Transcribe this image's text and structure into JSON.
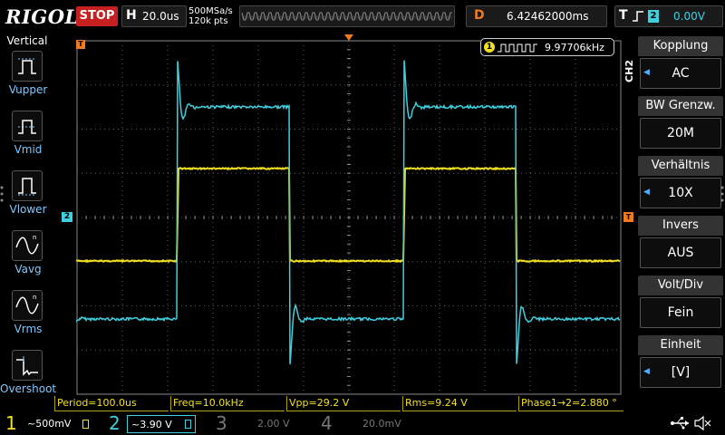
{
  "topbar": {
    "brand": "RIGOL",
    "run_state": "STOP",
    "timebase_letter": "H",
    "timebase": "20.0us",
    "sample_rate": "500MSa/s",
    "memory_depth": "120k pts",
    "delay_letter": "D",
    "delay": "6.42462000ms",
    "trigger_letter": "T",
    "trigger_source": "2",
    "trigger_level": "0.00V"
  },
  "leftbar": {
    "title": "Vertical",
    "items": [
      {
        "label": "Vupper",
        "icon": "vupper-icon"
      },
      {
        "label": "Vmid",
        "icon": "vmid-icon"
      },
      {
        "label": "Vlower",
        "icon": "vlower-icon"
      },
      {
        "label": "Vavg",
        "icon": "vavg-icon"
      },
      {
        "label": "Vrms",
        "icon": "vrms-icon"
      },
      {
        "label": "Overshoot",
        "icon": "overshoot-icon"
      }
    ]
  },
  "plot": {
    "counter_channel": "1",
    "counter_value": "9.97706kHz",
    "marker_trigger_left": "T",
    "marker_ch2": "2",
    "marker_trigger_right": "T",
    "colors": {
      "ch1": "#f0e020",
      "ch2": "#3fd0e0",
      "grid": "#5a5a5a",
      "marker": "#f07a20"
    }
  },
  "rightbar": {
    "channel_tag": "CH2",
    "items": [
      {
        "head": "Kopplung",
        "value": "AC",
        "has_arrow": true
      },
      {
        "head": "BW Grenzw.",
        "value": "20M",
        "has_arrow": false
      },
      {
        "head": "Verhältnis",
        "value": "10X",
        "has_arrow": true
      },
      {
        "head": "Invers",
        "value": "AUS",
        "has_arrow": false
      },
      {
        "head": "Volt/Div",
        "value": "Fein",
        "has_arrow": false
      },
      {
        "head": "Einheit",
        "value": "[V]",
        "has_arrow": true
      }
    ]
  },
  "measurements": [
    "Period=100.0us",
    "Freq=10.0kHz",
    "Vpp=29.2 V",
    "Rms=9.24 V",
    "Phase1→2=2.880 °"
  ],
  "bottombar": {
    "ch1_num": "1",
    "ch1_scale": "~500mV",
    "ch2_num": "2",
    "ch2_scale": "~3.90 V",
    "ch3_num": "3",
    "ch3_scale": "2.00 V",
    "ch4_num": "4",
    "ch4_scale": "20.0mV"
  }
}
